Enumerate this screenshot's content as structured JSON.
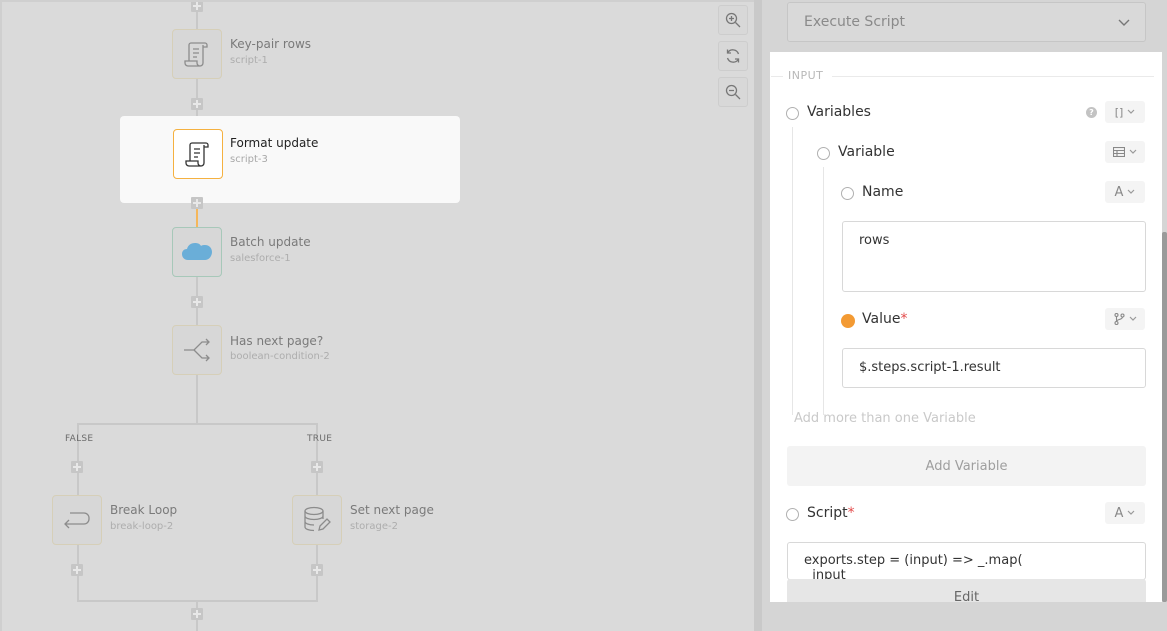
{
  "canvas": {
    "nodes": [
      {
        "id": "key-pair",
        "label": "Key-pair rows",
        "sub": "script-1",
        "icon": "script-icon"
      },
      {
        "id": "format",
        "label": "Format update",
        "sub": "script-3",
        "icon": "script-icon",
        "active": true
      },
      {
        "id": "batch",
        "label": "Batch update",
        "sub": "salesforce-1",
        "icon": "salesforce-icon"
      },
      {
        "id": "hasnext",
        "label": "Has next page?",
        "sub": "boolean-condition-2",
        "icon": "branch-icon"
      },
      {
        "id": "break",
        "label": "Break Loop",
        "sub": "break-loop-2",
        "icon": "loop-back-icon"
      },
      {
        "id": "setnext",
        "label": "Set next page",
        "sub": "storage-2",
        "icon": "database-edit-icon"
      }
    ],
    "branches": {
      "false_label": "FALSE",
      "true_label": "TRUE"
    },
    "zoom_controls": [
      "zoom-in-icon",
      "reset-zoom-icon",
      "zoom-out-icon"
    ]
  },
  "panel": {
    "action_select": {
      "value": "Execute Script"
    },
    "section_header": "INPUT",
    "variables": {
      "label": "Variables",
      "type_symbol": "[]",
      "variable": {
        "label": "Variable",
        "name": {
          "label": "Name",
          "type_symbol": "A",
          "value": "rows"
        },
        "value": {
          "label": "Value",
          "required_mark": "*",
          "value": "$.steps.script-1.result"
        }
      },
      "add_more_hint": "Add more than one Variable",
      "add_button": "Add Variable"
    },
    "script": {
      "label": "Script",
      "required_mark": "*",
      "type_symbol": "A",
      "code": "exports.step = (input) => _.map(\n  input",
      "edit_button": "Edit"
    }
  },
  "colors": {
    "accent_orange": "#f5b140",
    "required_red": "#e34b4b",
    "salesforce_blue": "#5aa7d8"
  }
}
